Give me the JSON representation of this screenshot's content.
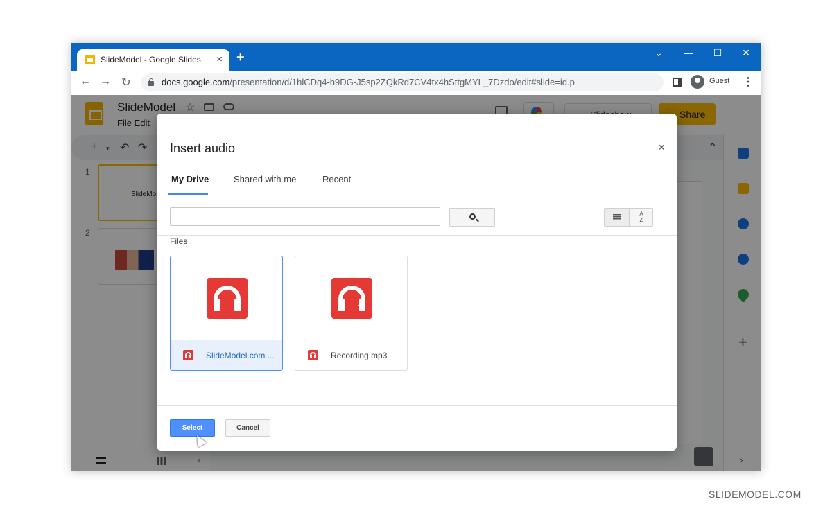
{
  "browser": {
    "tab_title": "SlideModel - Google Slides",
    "tab_close": "×",
    "new_tab": "+",
    "window_controls": {
      "dropdown": "⌄",
      "minimize": "—",
      "maximize": "☐",
      "close": "✕"
    },
    "nav": {
      "back": "←",
      "forward": "→",
      "reload": "↻"
    },
    "url_host": "docs.google.com",
    "url_path": "/presentation/d/1hlCDq4-h9DG-J5sp2ZQkRd7CV4tx4hSttgMYL_7Dzdo/edit#slide=id.p",
    "profile_label": "Guest",
    "menu": "⋮"
  },
  "app": {
    "title": "SlideModel",
    "menu": "File   Edit",
    "star": "☆",
    "slideshow_label": "Slideshow",
    "share_label": "Share",
    "toolbar": {
      "add": "+",
      "add_caret": "▾",
      "undo": "↶",
      "redo": "↷",
      "collapse": "⌃"
    },
    "slides": [
      {
        "num": "1",
        "text": "SlideMo"
      },
      {
        "num": "2"
      }
    ],
    "rail_plus": "+",
    "rail_arrow": "›",
    "collapse_panel": "‹"
  },
  "dialog": {
    "title": "Insert audio",
    "close": "×",
    "tabs": [
      "My Drive",
      "Shared with me",
      "Recent"
    ],
    "search_value": "",
    "sort_label": "A\nZ",
    "files_label": "Files",
    "files": [
      {
        "name": "SlideModel.com ...",
        "selected": true
      },
      {
        "name": "Recording.mp3",
        "selected": false
      }
    ],
    "select_label": "Select",
    "cancel_label": "Cancel"
  },
  "watermark": "SLIDEMODEL.COM",
  "colors": {
    "titlebar": "#0b66c2",
    "accent_blue": "#4d90fe",
    "audio_red": "#e53935",
    "share_yellow": "#fbbc04"
  }
}
